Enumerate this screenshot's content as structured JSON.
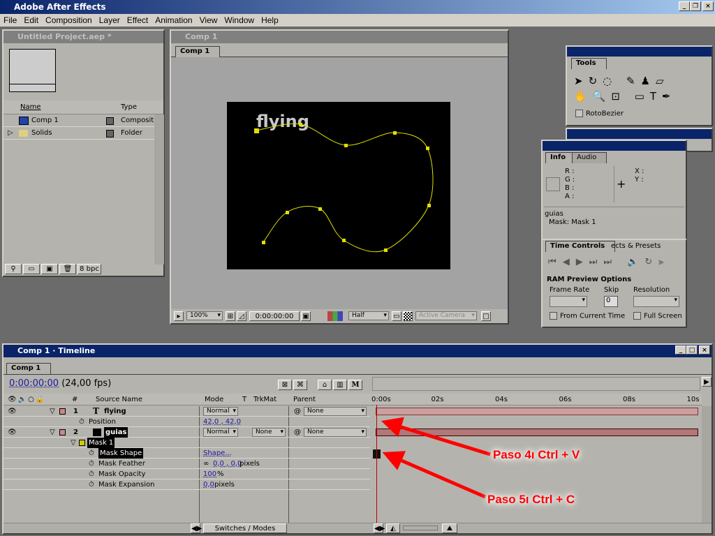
{
  "app": {
    "title": "Adobe After Effects"
  },
  "menu": [
    "File",
    "Edit",
    "Composition",
    "Layer",
    "Effect",
    "Animation",
    "View",
    "Window",
    "Help"
  ],
  "project": {
    "title": "Untitled Project.aep *",
    "col_name": "Name",
    "col_type": "Type",
    "items": [
      {
        "name": "Comp 1",
        "type": "Compositio"
      },
      {
        "name": "Solids",
        "type": "Folder"
      }
    ],
    "bpc": "8 bpc"
  },
  "comp": {
    "title": "Comp 1",
    "tab": "Comp 1",
    "layer_text": "flying",
    "zoom": "100%",
    "timecode": "0:00:00:00",
    "resolution": "Half",
    "camera": "Active Camera",
    "mask_color": "#e0e000"
  },
  "tools": {
    "tab": "Tools",
    "rotobezier": "RotoBezier"
  },
  "info": {
    "tabs": [
      "Info",
      "Audio"
    ],
    "r": "R :",
    "g": "G :",
    "b": "B :",
    "a": "A :",
    "x": "X :",
    "y": "Y :",
    "layer": "guias",
    "mask": "Mask: Mask 1"
  },
  "time_controls": {
    "tab": "Time Controls",
    "tab2": "ects & Presets",
    "ram_title": "RAM Preview Options",
    "frame_rate": "Frame Rate",
    "skip": "Skip",
    "skip_value": "0",
    "resolution": "Resolution",
    "from_current": "From Current Time",
    "full_screen": "Full Screen"
  },
  "timeline": {
    "title": "Comp 1 · Timeline",
    "tab": "Comp 1",
    "timecode": "0:00:00:00",
    "fps": "(24,00 fps)",
    "headers": {
      "num": "#",
      "source": "Source Name",
      "mode": "Mode",
      "t": "T",
      "trkmat": "TrkMat",
      "parent": "Parent"
    },
    "ruler": [
      "0:00s",
      "02s",
      "04s",
      "06s",
      "08s",
      "10s"
    ],
    "layers": [
      {
        "num": "1",
        "name": "flying",
        "mode": "Normal",
        "parent": "None",
        "prop": "Position",
        "prop_value": "42,0 , 42,0"
      },
      {
        "num": "2",
        "name": "guias",
        "mode": "Normal",
        "trkmat": "None",
        "parent": "None"
      }
    ],
    "mask": {
      "name": "Mask 1",
      "props": [
        {
          "name": "Mask Shape",
          "value": "Shape..."
        },
        {
          "name": "Mask Feather",
          "value": "0,0 , 0,0",
          "unit": "pixels"
        },
        {
          "name": "Mask Opacity",
          "value": "100",
          "unit": "%"
        },
        {
          "name": "Mask Expansion",
          "value": "0,0",
          "unit": "pixels"
        }
      ]
    },
    "switches_modes": "Switches / Modes"
  },
  "annotations": [
    {
      "text": "Paso 4ı Ctrl + V",
      "color": "#ff0000"
    },
    {
      "text": "Paso 5ı Ctrl + C",
      "color": "#ff0000"
    }
  ]
}
